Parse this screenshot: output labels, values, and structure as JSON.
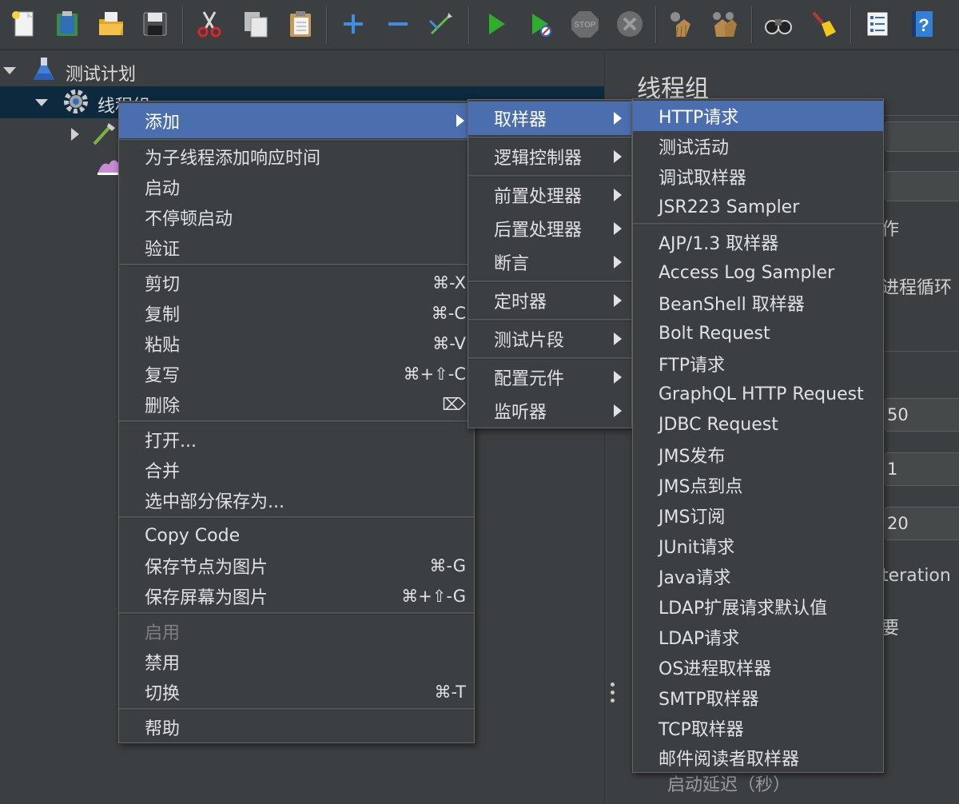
{
  "toolbar": {
    "icons": [
      "new-icon",
      "templates-icon",
      "open-icon",
      "save-icon",
      "cut-icon",
      "copy-icon",
      "paste-icon",
      "expand-icon",
      "collapse-icon",
      "toggle-icon",
      "start-icon",
      "start-no-pause-icon",
      "stop-icon",
      "shutdown-icon",
      "clear-icon",
      "clear-all-icon",
      "search-icon",
      "reset-search-icon",
      "function-helper-icon",
      "help-icon"
    ]
  },
  "tree": {
    "test_plan": "测试计划",
    "thread_group": "线程组"
  },
  "right_panel": {
    "title": "线程组",
    "frag_action": "作",
    "frag_loop": "进程循环",
    "val_threads": "50",
    "val_rampup": "1",
    "val_loops": "20",
    "frag_iteration": "teration",
    "frag_need": "要",
    "frag_delay": "启动延迟（秒）"
  },
  "context_menu": {
    "add": "添加",
    "add_think_time": "为子线程添加响应时间",
    "start": "启动",
    "start_no_pause": "不停顿启动",
    "validate": "验证",
    "cut": "剪切",
    "cut_sc": "⌘-X",
    "copy": "复制",
    "copy_sc": "⌘-C",
    "paste": "粘贴",
    "paste_sc": "⌘-V",
    "duplicate": "复写",
    "duplicate_sc": "⌘+⇧-C",
    "delete": "删除",
    "delete_sc": "⌦",
    "open": "打开...",
    "merge": "合并",
    "save_selection": "选中部分保存为...",
    "copy_code": "Copy Code",
    "save_node_image": "保存节点为图片",
    "save_node_image_sc": "⌘-G",
    "save_screen_image": "保存屏幕为图片",
    "save_screen_image_sc": "⌘+⇧-G",
    "enable": "启用",
    "disable": "禁用",
    "toggle": "切换",
    "toggle_sc": "⌘-T",
    "help": "帮助"
  },
  "add_submenu": {
    "sampler": "取样器",
    "logic_controller": "逻辑控制器",
    "pre_processors": "前置处理器",
    "post_processors": "后置处理器",
    "assertions": "断言",
    "timer": "定时器",
    "test_fragment": "测试片段",
    "config_element": "配置元件",
    "listener": "监听器"
  },
  "sampler_submenu": {
    "items_top": [
      "HTTP请求",
      "测试活动",
      "调试取样器",
      "JSR223 Sampler"
    ],
    "items_bottom": [
      "AJP/1.3 取样器",
      "Access Log Sampler",
      "BeanShell 取样器",
      "Bolt Request",
      "FTP请求",
      "GraphQL HTTP Request",
      "JDBC Request",
      "JMS发布",
      "JMS点到点",
      "JMS订阅",
      "JUnit请求",
      "Java请求",
      "LDAP扩展请求默认值",
      "LDAP请求",
      "OS进程取样器",
      "SMTP取样器",
      "TCP取样器",
      "邮件阅读者取样器"
    ]
  },
  "colors": {
    "background": "#3c3f41",
    "highlight": "#4b6eaf",
    "tree_selected": "#0d293e",
    "text": "#dfe1e5",
    "disabled_text": "#7d7f81"
  }
}
